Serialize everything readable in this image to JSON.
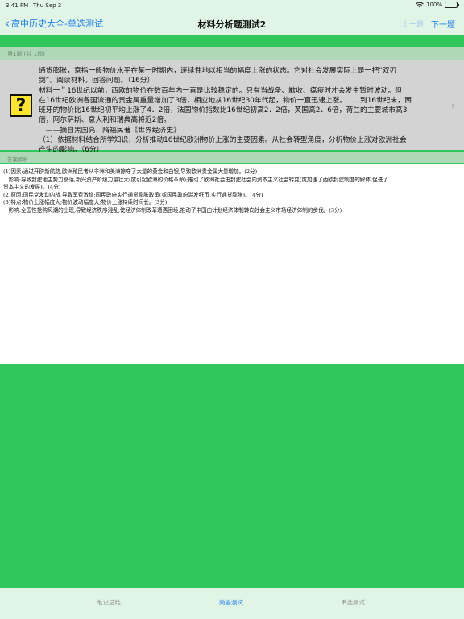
{
  "status_bar": {
    "time": "3:41 PM",
    "date": "Thu Sep 3",
    "battery": "100%",
    "battery_level": 1.0
  },
  "nav": {
    "back_label": "高中历史大全-单选测试",
    "title": "材料分析题测试2",
    "prev_label": "上一题",
    "next_label": "下一题"
  },
  "question": {
    "counter": "第1题 (共 1题)",
    "icon_glyph": "?",
    "lines": [
      "通货膨胀，意指一般物价水平在某一时期内，连续性地以相当的幅度上涨的状态。它对社会发展实际上是一把“双刃",
      "剑”。阅读材料，回答问题。（16分）",
      "材料一＂16世纪以前，西欧的物价在数百年内一直是比较稳定的。只有当战争、歉收、瘟疫时才会发生暂时波动。但",
      "在16世纪欧洲各国流通的贵金属重量增加了3倍，相应地从16世纪30年代起，物价一直迅速上涨。......到16世纪末，西",
      "班牙的物价比16世纪初平均上涨了4．2倍，法国物价指数比16世纪初高2．2倍，英国高2．6倍，荷兰的主要城市高3",
      "倍，阿尔萨斯、意大利和瑞典高将近2倍。",
      "　——摘自黑国亮、隋福民著《世界经济史》",
      "（1）依据材料结合所学知识，分析推动16世纪欧洲物价上涨的主要因素。从社会转型角度，分析物价上涨对欧洲社会",
      "产生的影响。（6分）"
    ]
  },
  "answer": {
    "label": "答案解析",
    "lines": [
      "(1)因素:通过开辟新航路,欧洲殖民者从非洲和美洲掠夺了大量的黄金和白银,导致欧洲贵金属大量增加。(2分)",
      "　影响:导致封建地主势力衰落,新兴资产阶级力量壮大(或引起欧洲的价格革命);推动了欧洲社会由封建社会向资本主义社会转变(或加速了西欧封建制度的解体,促进了",
      "资本主义的发展)。(4分)",
      "(2)原因:国民党发动内战,导致军费激增;国民政府实行通货膨胀政策(或国民政府滥发纸币,实行通货膨胀)。(4分)",
      "(3)特点:物价上涨幅度大;物价波动幅度大;物价上涨持续时间长。(3分)",
      "　影响:全国性抢购风潮的出现,导致经济秩序混乱,使经济体制改革遭遇困境;推动了中国由计划经济体制转向社会主义市场经济体制的步伐。(3分)"
    ]
  },
  "tabs": [
    {
      "label": "笔记总结",
      "active": false
    },
    {
      "label": "简答测试",
      "active": true
    },
    {
      "label": "单选测试",
      "active": false
    }
  ],
  "colors": {
    "accent": "#1a7cf0",
    "green": "#32c75c",
    "light_green": "#e1f5e6"
  }
}
